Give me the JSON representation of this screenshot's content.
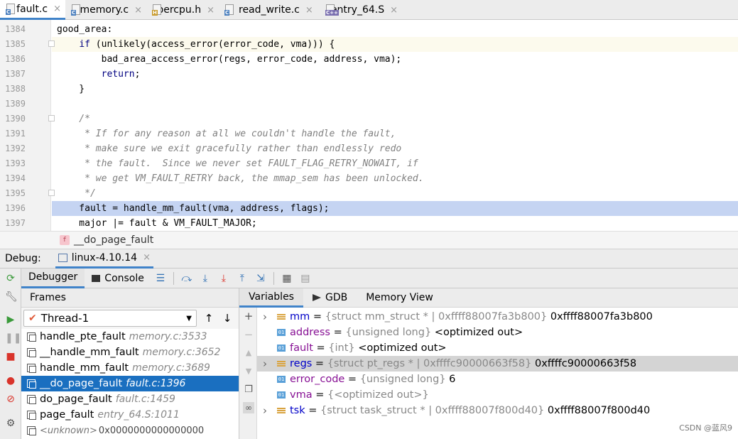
{
  "tabs": [
    {
      "name": "fault.c",
      "icon": "c-file-icon",
      "kind": "C",
      "active": true
    },
    {
      "name": "memory.c",
      "icon": "c-file-icon",
      "kind": "C",
      "active": false
    },
    {
      "name": "percpu.h",
      "icon": "h-file-icon",
      "kind": "H",
      "active": false
    },
    {
      "name": "read_write.c",
      "icon": "c-file-icon",
      "kind": "C",
      "active": false
    },
    {
      "name": "entry_64.S",
      "icon": "asm-file-icon",
      "kind": "C++",
      "active": false
    }
  ],
  "tab_close": "×",
  "editor": {
    "lines": [
      {
        "n": "1384",
        "code": "good_area:"
      },
      {
        "n": "1385",
        "code": "    if (unlikely(access_error(error_code, vma))) {"
      },
      {
        "n": "1386",
        "code": "        bad_area_access_error(regs, error_code, address, vma);"
      },
      {
        "n": "1387",
        "code": "        return;"
      },
      {
        "n": "1388",
        "code": "    }"
      },
      {
        "n": "1389",
        "code": ""
      },
      {
        "n": "1390",
        "code": "    /*"
      },
      {
        "n": "1391",
        "code": "     * If for any reason at all we couldn't handle the fault,"
      },
      {
        "n": "1392",
        "code": "     * make sure we exit gracefully rather than endlessly redo"
      },
      {
        "n": "1393",
        "code": "     * the fault.  Since we never set FAULT_FLAG_RETRY_NOWAIT, if"
      },
      {
        "n": "1394",
        "code": "     * we get VM_FAULT_RETRY back, the mmap_sem has been unlocked."
      },
      {
        "n": "1395",
        "code": "     */"
      },
      {
        "n": "1396",
        "code": "    fault = handle_mm_fault(vma, address, flags);"
      },
      {
        "n": "1397",
        "code": "    major |= fault & VM_FAULT_MAJOR;"
      }
    ]
  },
  "breadcrumb": {
    "badge": "f",
    "text": "__do_page_fault"
  },
  "debug": {
    "title": "Debug:",
    "session": "linux-4.10.14",
    "close": "×"
  },
  "debugger_tabs": {
    "debugger": "Debugger",
    "console": "Console"
  },
  "frames": {
    "header": "Frames",
    "thread": "Thread-1",
    "items": [
      {
        "fn": "handle_pte_fault",
        "loc": "memory.c:3533",
        "selected": false
      },
      {
        "fn": "__handle_mm_fault",
        "loc": "memory.c:3652",
        "selected": false
      },
      {
        "fn": "handle_mm_fault",
        "loc": "memory.c:3689",
        "selected": false
      },
      {
        "fn": "__do_page_fault",
        "loc": "fault.c:1396",
        "selected": true
      },
      {
        "fn": "do_page_fault",
        "loc": "fault.c:1459",
        "selected": false
      },
      {
        "fn": "page_fault",
        "loc": "entry_64.S:1011",
        "selected": false
      },
      {
        "fn": "<unknown>",
        "addr": "0x0000000000000000",
        "selected": false
      }
    ]
  },
  "variables": {
    "tabs": {
      "variables": "Variables",
      "gdb": "GDB",
      "memory": "Memory View"
    },
    "items": [
      {
        "name": "mm",
        "type": "{struct mm_struct * | 0xffff88007fa3b800}",
        "value": "0xffff88007fa3b800",
        "expandable": true,
        "kind": "struct"
      },
      {
        "name": "address",
        "type": "{unsigned long}",
        "value": "<optimized out>",
        "expandable": false,
        "kind": "prim"
      },
      {
        "name": "fault",
        "type": "{int}",
        "value": "<optimized out>",
        "expandable": false,
        "kind": "prim"
      },
      {
        "name": "regs",
        "type": "{struct pt_regs * | 0xffffc90000663f58}",
        "value": "0xffffc90000663f58",
        "expandable": true,
        "kind": "struct",
        "selected": true
      },
      {
        "name": "error_code",
        "type": "{unsigned long}",
        "value": "6",
        "expandable": false,
        "kind": "prim"
      },
      {
        "name": "vma",
        "type": "{<optimized out>}",
        "value": "",
        "expandable": false,
        "kind": "prim"
      },
      {
        "name": "tsk",
        "type": "{struct task_struct * | 0xffff88007f800d40}",
        "value": "0xffff88007f800d40",
        "expandable": true,
        "kind": "struct"
      }
    ]
  },
  "watermark": "CSDN @蓝风9",
  "colors": {
    "accent": "#4083c9",
    "selected_frame": "#1a6fc0",
    "exec_line": "#c5d4f2"
  }
}
